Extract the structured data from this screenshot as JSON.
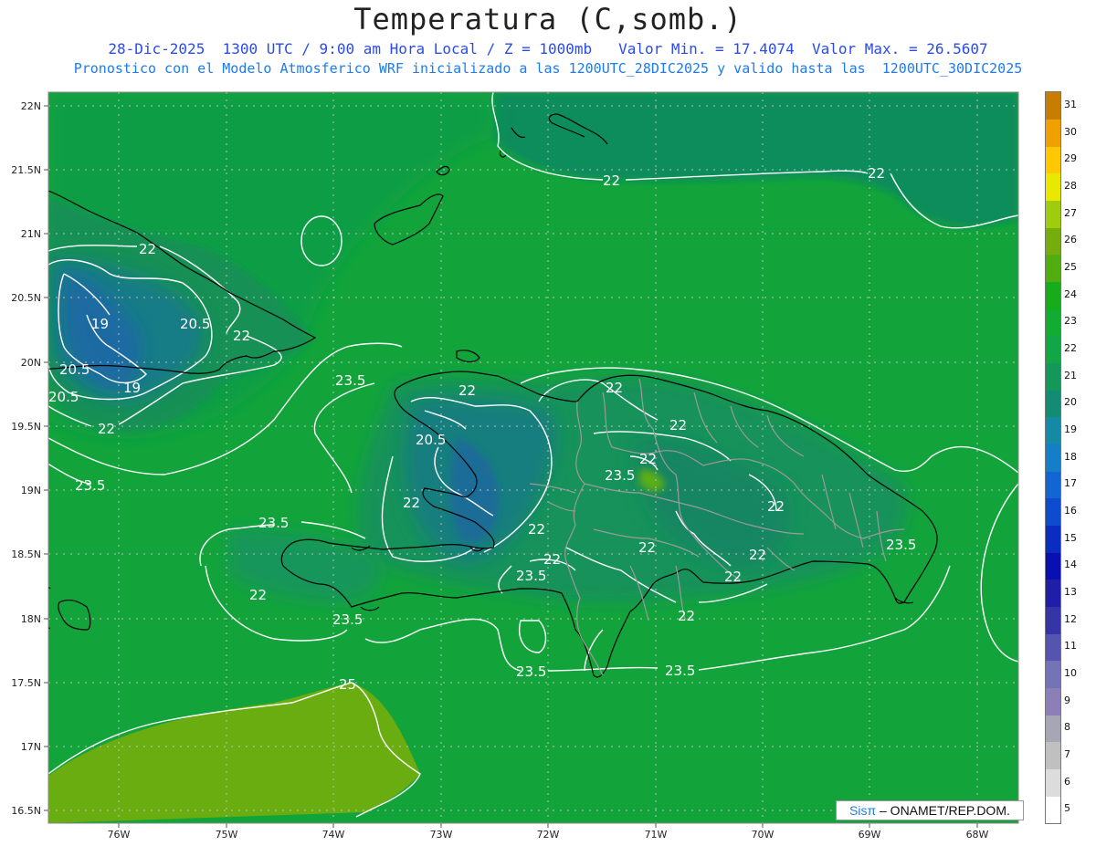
{
  "header": {
    "title": "Temperatura (C,somb.)",
    "line1": "28-Dic-2025  1300 UTC / 9:00 am Hora Local / Z = 1000mb   Valor Min. = 17.4074  Valor Max. = 26.5607",
    "line2": "Pronostico con el Modelo Atmosferico WRF inicializado a las 1200UTC_28DIC2025 y valido hasta las  1200UTC_30DIC2025"
  },
  "axes": {
    "lat_labels": [
      "22N",
      "21.5N",
      "21N",
      "20.5N",
      "20N",
      "19.5N",
      "19N",
      "18.5N",
      "18N",
      "17.5N",
      "17N",
      "16.5N"
    ],
    "lon_labels": [
      "76W",
      "75W",
      "74W",
      "73W",
      "72W",
      "71W",
      "70W",
      "69W",
      "68W"
    ]
  },
  "contour_labels": [
    "22",
    "22",
    "22",
    "19",
    "20.5",
    "22",
    "20.5",
    "20.5",
    "19",
    "22",
    "23.5",
    "22",
    "20.5",
    "23.5",
    "22",
    "22",
    "22",
    "23.5",
    "22",
    "22",
    "22",
    "23.5",
    "22",
    "22",
    "23.5",
    "22",
    "22",
    "23.5",
    "22",
    "23.5",
    "22",
    "23.5",
    "23.5",
    "25"
  ],
  "colorbar": {
    "levels": [
      "5",
      "6",
      "7",
      "8",
      "9",
      "10",
      "11",
      "12",
      "13",
      "14",
      "15",
      "16",
      "17",
      "18",
      "19",
      "20",
      "21",
      "22",
      "23",
      "24",
      "25",
      "26",
      "27",
      "28",
      "29",
      "30",
      "31"
    ],
    "colors": [
      "#ffffff",
      "#dcdcdc",
      "#c0c0c0",
      "#a6a6b4",
      "#8c7fb8",
      "#7373b8",
      "#5555b0",
      "#3535a8",
      "#1e1ea6",
      "#0a10b0",
      "#0a2cc0",
      "#0d4ccc",
      "#1266d2",
      "#147ec8",
      "#158aa6",
      "#148c74",
      "#13985a",
      "#12a646",
      "#12ac32",
      "#16ad1c",
      "#52ad10",
      "#74ad0c",
      "#a0cc10",
      "#e8e800",
      "#ffc800",
      "#f0a000",
      "#c87c00"
    ]
  },
  "credit": {
    "sis": "Sisπ",
    "org": "– ONAMET/REP.DOM."
  }
}
